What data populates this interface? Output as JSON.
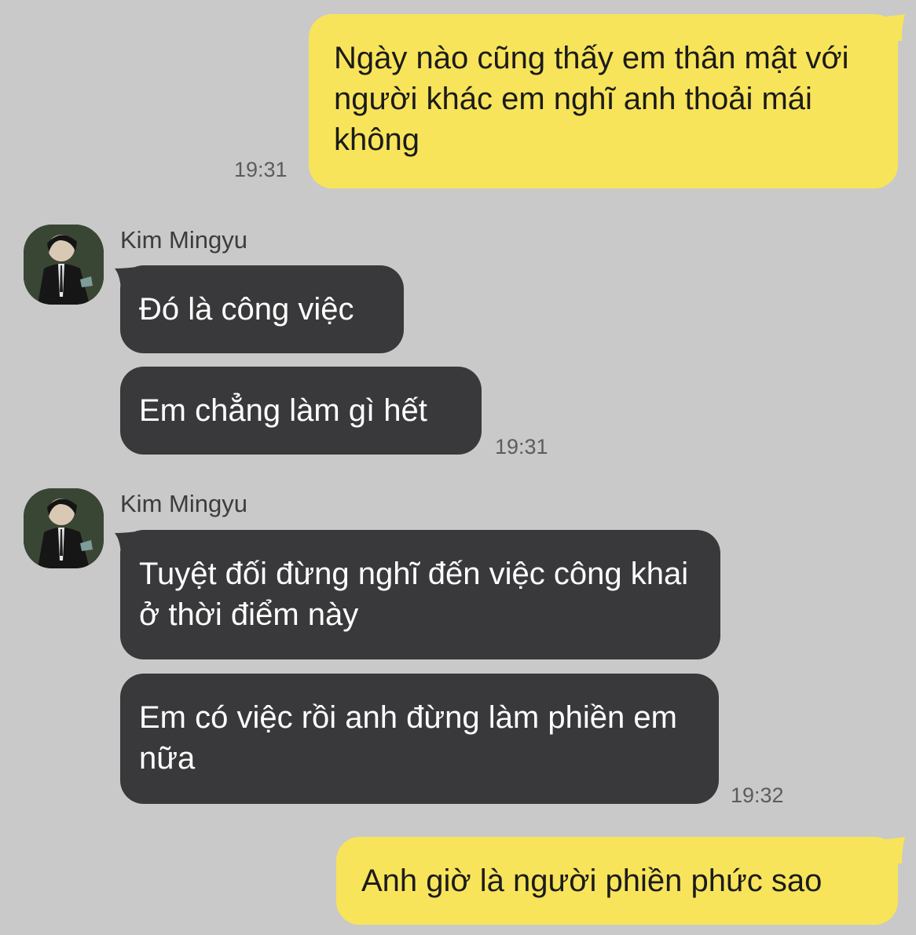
{
  "messages": [
    {
      "text": "Ngày nào cũng thấy em thân mật với người khác em nghĩ anh thoải mái không",
      "time": "19:31"
    },
    {
      "sender": "Kim Mingyu",
      "bubbles": [
        "Đó là công việc",
        "Em chẳng làm gì hết"
      ],
      "time": "19:31"
    },
    {
      "sender": "Kim Mingyu",
      "bubbles": [
        "Tuyệt đối đừng nghĩ đến việc công khai ở thời điểm này",
        "Em có việc rồi anh đừng làm phiền em nữa"
      ],
      "time": "19:32"
    },
    {
      "text": "Anh giờ là người phiền phức sao"
    }
  ],
  "colors": {
    "background": "#c9c9c9",
    "outgoing_bubble": "#f8e45a",
    "incoming_bubble": "#39393b",
    "incoming_text": "#ffffff",
    "timestamp": "#5c5c5c"
  },
  "icons": [
    "avatar-kim-mingyu"
  ]
}
